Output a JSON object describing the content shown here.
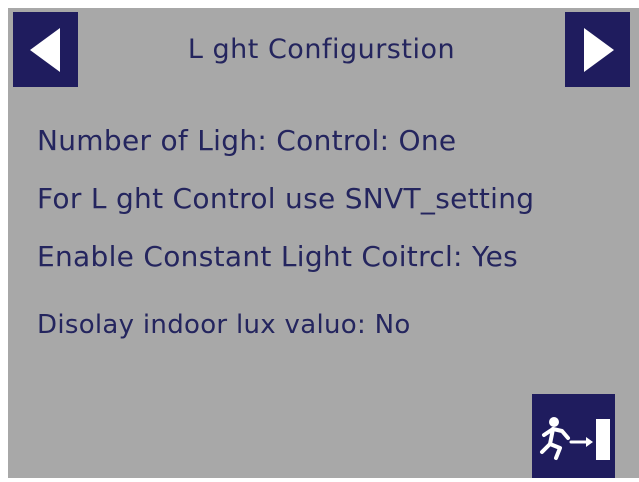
{
  "header": {
    "title": "L ght  Configurstion",
    "prev_icon": "left-triangle-arrow",
    "next_icon": "right-triangle-arrow"
  },
  "settings": [
    {
      "text": "Number  of  Ligh:  Control:  One"
    },
    {
      "text": "For  L ght  Control  use  SNVT_setting"
    },
    {
      "text": "Enable  Constant  Light  Coitrcl:  Yes"
    },
    {
      "text": "Disolay  indoor  lux  valuo:  No"
    }
  ],
  "footer": {
    "exit_icon": "running-person-exit-door-icon"
  },
  "colors": {
    "background": "#a8a8a8",
    "button": "#1f1c5e",
    "text": "#24255e",
    "icon": "#ffffff"
  }
}
